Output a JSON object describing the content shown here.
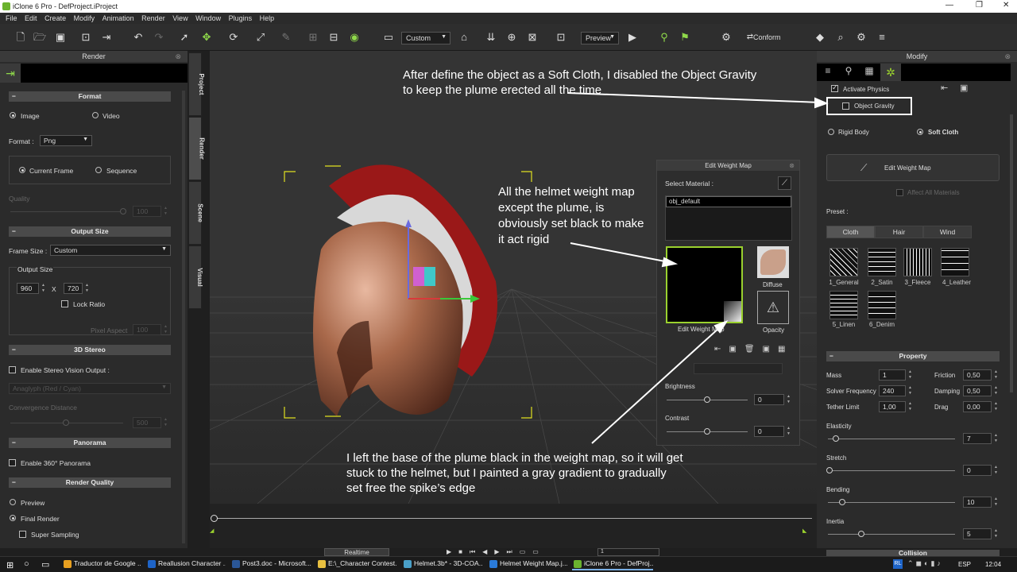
{
  "window": {
    "title": "iClone 6 Pro - DefProject.iProject"
  },
  "menu": [
    "File",
    "Edit",
    "Create",
    "Modify",
    "Animation",
    "Render",
    "View",
    "Window",
    "Plugins",
    "Help"
  ],
  "toolbar": {
    "camera_select": "Custom",
    "preview_select": "Preview",
    "conform": "Conform"
  },
  "render_panel": {
    "title": "Render",
    "format_section": "Format",
    "image": "Image",
    "video": "Video",
    "format_label": "Format :",
    "format_value": "Png",
    "current_frame": "Current Frame",
    "sequence": "Sequence",
    "quality": "Quality",
    "quality_value": "100",
    "output_size_section": "Output Size",
    "frame_size_label": "Frame Size :",
    "frame_size_value": "Custom",
    "output_size_label": "Output Size",
    "width": "960",
    "x": "X",
    "height": "720",
    "lock_ratio": "Lock Ratio",
    "pixel_aspect": "Pixel Aspect",
    "pixel_aspect_value": "100",
    "stereo_section": "3D Stereo",
    "enable_stereo": "Enable Stereo Vision Output :",
    "anaglyph": "Anaglyph (Red / Cyan)",
    "convergence": "Convergence Distance",
    "convergence_value": "500",
    "panorama_section": "Panorama",
    "enable_panorama": "Enable 360° Panorama",
    "quality_section": "Render Quality",
    "preview": "Preview",
    "final_render": "Final Render",
    "super_sampling": "Super Sampling"
  },
  "vtabs": [
    "Project",
    "Render",
    "Scene",
    "Visual"
  ],
  "weight_map": {
    "title": "Edit Weight Map",
    "select_material": "Select Material :",
    "material": "obj_default",
    "diffuse": "Diffuse",
    "edit_weight_map": "Edit Weight Map",
    "opacity": "Opacity",
    "brightness": "Brightness",
    "brightness_value": "0",
    "contrast": "Contrast",
    "contrast_value": "0"
  },
  "modify_panel": {
    "title": "Modify",
    "activate_physics": "Activate Physics",
    "object_gravity": "Object Gravity",
    "rigid_body": "Rigid Body",
    "soft_cloth": "Soft Cloth",
    "edit_weight_map": "Edit Weight Map",
    "affect_all": "Affect All Materials",
    "preset": "Preset :",
    "preset_tabs": [
      "Cloth",
      "Hair",
      "Wind"
    ],
    "presets": [
      "1_General",
      "2_Satin",
      "3_Fleece",
      "4_Leather",
      "5_Linen",
      "6_Denim"
    ],
    "property_section": "Property",
    "mass_label": "Mass",
    "mass": "1",
    "friction_label": "Friction",
    "friction": "0,50",
    "solver_label": "Solver Frequency",
    "solver": "240",
    "damping_label": "Damping",
    "damping": "0,50",
    "tether_label": "Tether Limit",
    "tether": "1,00",
    "drag_label": "Drag",
    "drag": "0,00",
    "elasticity_label": "Elasticity",
    "elasticity": "7",
    "stretch_label": "Stretch",
    "stretch": "0",
    "bending_label": "Bending",
    "bending": "10",
    "inertia_label": "Inertia",
    "inertia": "5",
    "collision_section": "Collision"
  },
  "timeline": {
    "realtime": "Realtime",
    "frame": "1"
  },
  "annotations": {
    "gravity": [
      "After define the object as a Soft Cloth, I disabled the Object Gravity",
      "to keep the plume erected all the time"
    ],
    "weight": [
      "All the helmet weight map",
      "except the plume, is",
      "obviously set black to make",
      "it act rigid"
    ],
    "base": [
      "I left the base of the plume black in the weight map, so it will get",
      "stuck to the helmet, but I painted a gray gradient to gradually",
      "set free the spike’s edge"
    ]
  },
  "taskbar": {
    "items": [
      "Traductor de Google ...",
      "Reallusion Character ...",
      "Post3.doc - Microsoft...",
      "E:\\_Character Contest...",
      "Helmet.3b* - 3D-COA...",
      "Helmet Weight Map.j...",
      "iClone 6 Pro - DefProj..."
    ],
    "lang": "ESP",
    "time": "12:04"
  }
}
